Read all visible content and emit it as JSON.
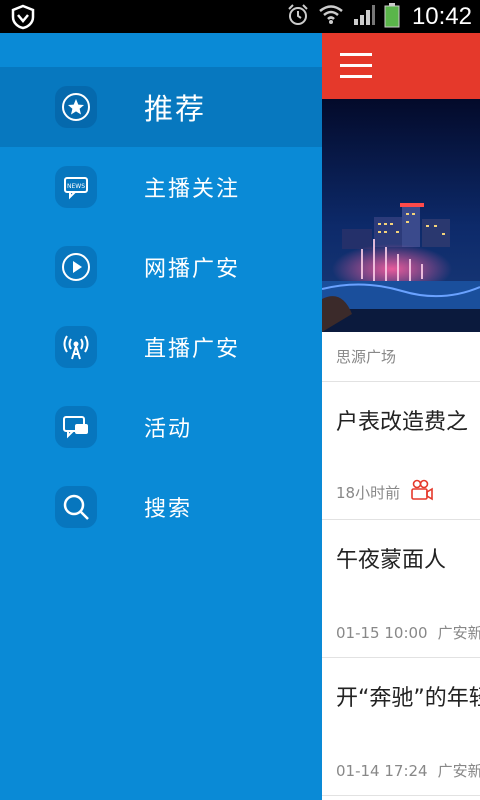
{
  "status_bar": {
    "time": "10:42",
    "icons": [
      "shield-icon",
      "alarm-icon",
      "wifi-icon",
      "signal-icon",
      "battery-icon"
    ]
  },
  "drawer": {
    "background": "#0a8ad6",
    "items": [
      {
        "label": "推荐",
        "icon": "star-icon",
        "active": true
      },
      {
        "label": "主播关注",
        "icon": "news-icon"
      },
      {
        "label": "网播广安",
        "icon": "play-icon"
      },
      {
        "label": "直播广安",
        "icon": "broadcast-icon"
      },
      {
        "label": "活动",
        "icon": "chat-icon"
      },
      {
        "label": "搜索",
        "icon": "search-icon"
      }
    ]
  },
  "content": {
    "header_color": "#e5392b",
    "hero_caption": "思源广场",
    "news": [
      {
        "title": "户表改造费之",
        "meta_time": "18小时前",
        "meta_source": "",
        "has_video": true
      },
      {
        "title": "午夜蒙面人",
        "meta_time": "01-15 10:00",
        "meta_source": "广安新"
      },
      {
        "title": "开“奔驰”的年轻",
        "meta_time": "01-14 17:24",
        "meta_source": "广安新"
      }
    ]
  }
}
